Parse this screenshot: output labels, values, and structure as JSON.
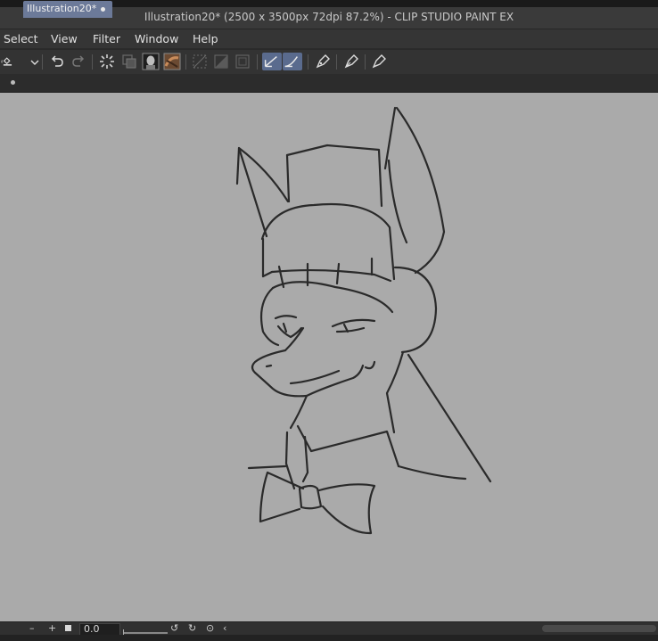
{
  "window": {
    "title": "Illustration20* (2500 x 3500px 72dpi 87.2%)  - CLIP STUDIO PAINT EX"
  },
  "menu": {
    "items": [
      "Select",
      "View",
      "Filter",
      "Window",
      "Help"
    ]
  },
  "toolbar": {
    "icons": [
      "bucket-icon",
      "dropdown-icon",
      "undo-icon",
      "redo-icon",
      "loading-icon",
      "layer-icon",
      "portrait-thumbnail-icon",
      "brush-thumbnail-icon",
      "selection-icon",
      "clear-icon",
      "fill-icon",
      "snap-ruler-icon",
      "snap-special-ruler-icon",
      "pen-icon",
      "pen-outline-icon",
      "pen-tip-icon"
    ],
    "active": [
      "snap-ruler-icon",
      "snap-special-ruler-icon"
    ]
  },
  "tabs": [
    {
      "label": "Illustration20*",
      "active": true
    }
  ],
  "status": {
    "zoom_out": "–",
    "zoom_in": "+",
    "angle_value": "0.0"
  },
  "colors": {
    "canvas_bg": "#aaaaaa",
    "active_tab": "#6c7a99",
    "active_tool": "#5a6b8e"
  }
}
